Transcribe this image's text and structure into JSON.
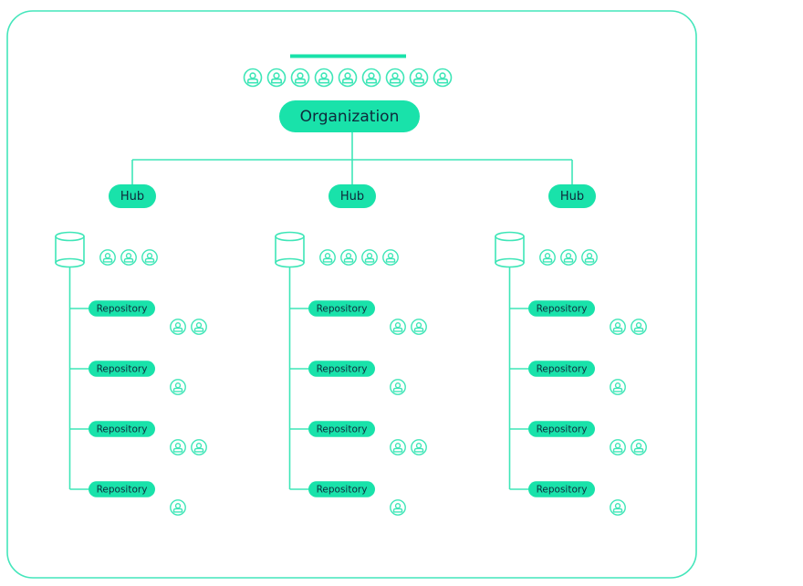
{
  "colors": {
    "accent": "#19e2aa",
    "accent_line": "#3ee6b7",
    "frame": "#44e6bb",
    "text": "#0e2a3b",
    "background": "#ffffff"
  },
  "organization": {
    "label": "Organization",
    "member_count": 9,
    "member_icon": "user-icon"
  },
  "hubs": [
    {
      "label": "Hub",
      "storage_icon": "database-icon",
      "member_count": 3,
      "repositories": [
        {
          "label": "Repository",
          "member_count": 2
        },
        {
          "label": "Repository",
          "member_count": 1
        },
        {
          "label": "Repository",
          "member_count": 2
        },
        {
          "label": "Repository",
          "member_count": 1
        }
      ]
    },
    {
      "label": "Hub",
      "storage_icon": "database-icon",
      "member_count": 4,
      "repositories": [
        {
          "label": "Repository",
          "member_count": 2
        },
        {
          "label": "Repository",
          "member_count": 1
        },
        {
          "label": "Repository",
          "member_count": 2
        },
        {
          "label": "Repository",
          "member_count": 1
        }
      ]
    },
    {
      "label": "Hub",
      "storage_icon": "database-icon",
      "member_count": 3,
      "repositories": [
        {
          "label": "Repository",
          "member_count": 2
        },
        {
          "label": "Repository",
          "member_count": 1
        },
        {
          "label": "Repository",
          "member_count": 2
        },
        {
          "label": "Repository",
          "member_count": 1
        }
      ]
    }
  ]
}
